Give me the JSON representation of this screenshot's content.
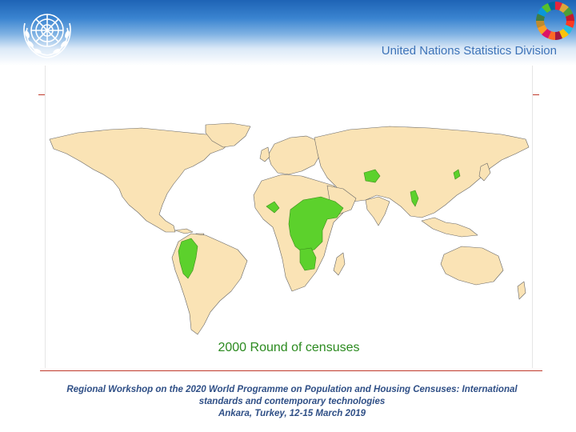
{
  "header": {
    "org_name": "United Nations Statistics Division",
    "colors": {
      "band_top": "#1e63b5",
      "title": "#3d73b8"
    },
    "icons": [
      "un-emblem-icon",
      "sdg-wheel-icon"
    ]
  },
  "map": {
    "caption": "2000 Round of censuses",
    "colors": {
      "ocean": "#ffffff",
      "land": "#fae3b5",
      "highlight": "#5cd12c",
      "border": "#555555",
      "caption": "#2b8a1f"
    },
    "highlighted_regions": [
      "Colombia",
      "Ecuador",
      "Peru",
      "Nigeria",
      "Cameroon",
      "Central African Republic",
      "Chad",
      "Sudan",
      "Democratic Republic of the Congo",
      "Angola",
      "Ethiopia",
      "Guinea",
      "Liberia",
      "Afghanistan",
      "Myanmar",
      "North Korea"
    ]
  },
  "footer": {
    "line1": "Regional Workshop on the 2020 World Programme on Population and Housing Censuses: International",
    "line2": "standards and contemporary technologies",
    "line3": "Ankara, Turkey, 12-15 March 2019",
    "color": "#2f4f86"
  }
}
